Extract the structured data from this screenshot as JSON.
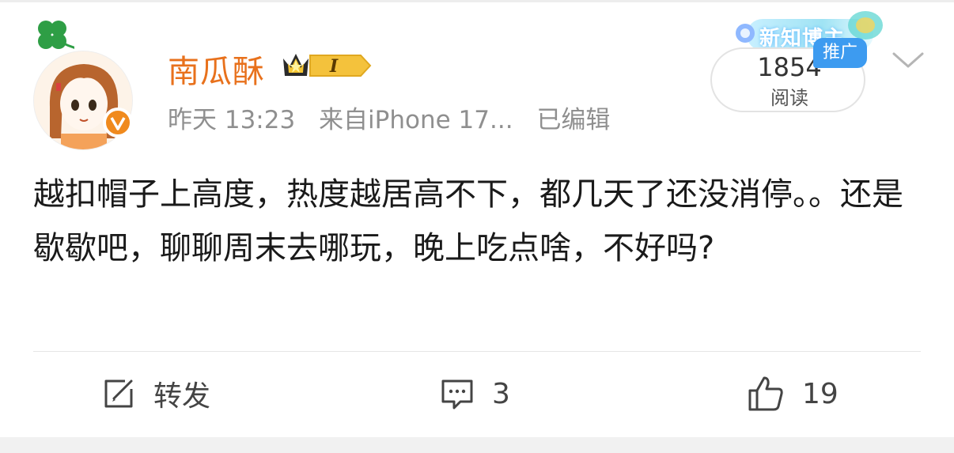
{
  "post": {
    "username": "南瓜酥",
    "level_badge": "I",
    "time": "昨天 13:23",
    "source": "来自iPhone 17...",
    "edited": "已编辑",
    "banner_text": "新知博主",
    "read_count": "1854",
    "read_label": "阅读",
    "promo_tag": "推广",
    "content": "越扣帽子上高度，热度越居高不下，都几天了还没消停。。还是歇歇吧，聊聊周末去哪玩，晚上吃点啥，不好吗?"
  },
  "actions": {
    "repost_label": "转发",
    "comment_count": "3",
    "like_count": "19"
  },
  "icons": {
    "avatar": "avatar-anime-girl",
    "verified": "verified-v-icon",
    "level": "crown-level-icon",
    "chevron": "chevron-down-icon",
    "repost": "repost-icon",
    "comment": "comment-icon",
    "like": "thumbs-up-icon"
  },
  "colors": {
    "username": "#e8711c",
    "verified": "#f08a1d",
    "promo": "#3d9bf0",
    "meta_text": "#8f8f8f"
  }
}
